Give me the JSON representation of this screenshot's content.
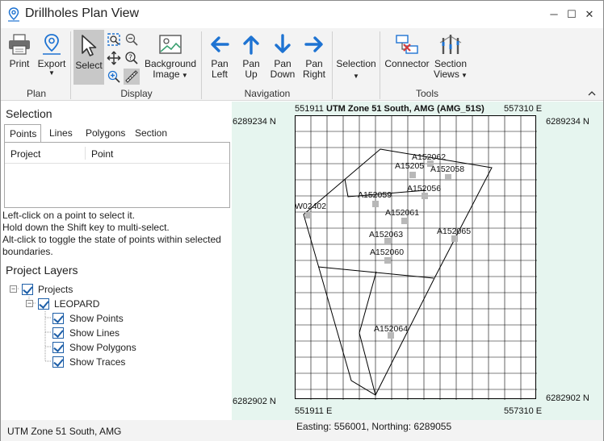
{
  "window": {
    "title": "Drillholes Plan View",
    "minimize": "─",
    "maximize": "☐",
    "close": "✕"
  },
  "ribbon": {
    "print": "Print",
    "export": "Export",
    "select": "Select",
    "background_line1": "Background",
    "background_line2": "Image",
    "pan_left_1": "Pan",
    "pan_left_2": "Left",
    "pan_up_1": "Pan",
    "pan_up_2": "Up",
    "pan_down_1": "Pan",
    "pan_down_2": "Down",
    "pan_right_1": "Pan",
    "pan_right_2": "Right",
    "selection": "Selection",
    "connector": "Connector",
    "section_views_1": "Section",
    "section_views_2": "Views",
    "groups": {
      "plan": "Plan",
      "display": "Display",
      "navigation": "Navigation",
      "tools": "Tools"
    },
    "collapse": "^"
  },
  "selection_panel": {
    "title": "Selection",
    "tabs": [
      "Points",
      "Lines",
      "Polygons",
      "Section"
    ],
    "active_tab": "Points",
    "columns": [
      "Project",
      "Point"
    ],
    "help_lines": [
      "Left-click on a point to select it.",
      "Hold down the Shift key to multi-select.",
      "Alt-click to toggle the state of points within selected",
      "boundaries."
    ]
  },
  "layers_panel": {
    "title": "Project Layers",
    "root": "Projects",
    "project": "LEOPARD",
    "items": [
      "Show Points",
      "Show Lines",
      "Show Polygons",
      "Show Traces"
    ]
  },
  "map": {
    "projection_title": "UTM Zone 51 South, AMG (AMG_51S)",
    "top_left_easting": "551911",
    "top_right_easting": "557310 E",
    "bottom_left_easting": "551911 E",
    "bottom_right_easting": "557310 E",
    "top_northing_left": "6289234 N",
    "top_northing_right": "6289234 N",
    "bottom_northing_left": "6282902 N",
    "bottom_northing_right": "6282902 N",
    "points": [
      {
        "id": "A152062"
      },
      {
        "id": "A152058"
      },
      {
        "id": "A152057",
        "label": "A15205"
      },
      {
        "id": "A152056"
      },
      {
        "id": "A152059"
      },
      {
        "id": "W02402"
      },
      {
        "id": "A152061"
      },
      {
        "id": "A152065"
      },
      {
        "id": "A152063"
      },
      {
        "id": "A152060"
      },
      {
        "id": "A152064"
      }
    ]
  },
  "status": {
    "projection": "UTM Zone 51 South, AMG",
    "cursor": "Easting: 556001, Northing: 6289055"
  },
  "colors": {
    "accent": "#1e73d2",
    "map_bg": "#e6f5ef",
    "ribbon_bg": "#f3f3f3",
    "connector_red": "#d63a3a"
  }
}
